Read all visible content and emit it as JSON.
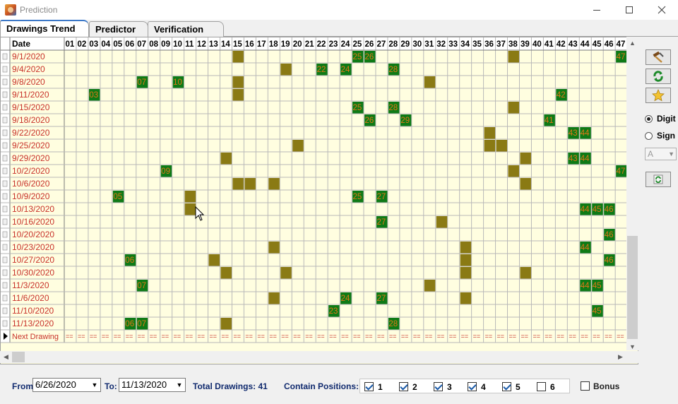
{
  "window": {
    "title": "Prediction"
  },
  "tabs": [
    {
      "label": "Drawings Trend",
      "active": true
    },
    {
      "label": "Predictor",
      "active": false
    },
    {
      "label": "Verification",
      "active": false
    }
  ],
  "grid": {
    "date_header": "Date",
    "columns": [
      "01",
      "02",
      "03",
      "04",
      "05",
      "06",
      "07",
      "08",
      "09",
      "10",
      "11",
      "12",
      "13",
      "14",
      "15",
      "16",
      "17",
      "18",
      "19",
      "20",
      "21",
      "22",
      "23",
      "24",
      "25",
      "26",
      "27",
      "28",
      "29",
      "30",
      "31",
      "32",
      "33",
      "34",
      "35",
      "36",
      "37",
      "38",
      "39",
      "40",
      "41",
      "42",
      "43",
      "44",
      "45",
      "46",
      "47"
    ],
    "rows": [
      {
        "date": "9/1/2020",
        "cells": [
          [
            "15",
            ""
          ],
          [
            "25",
            "25"
          ],
          [
            "26",
            "26"
          ],
          [
            "38",
            ""
          ],
          [
            "47",
            "47"
          ]
        ]
      },
      {
        "date": "9/4/2020",
        "cells": [
          [
            "19",
            ""
          ],
          [
            "22",
            "22"
          ],
          [
            "24",
            "24"
          ],
          [
            "28",
            "28"
          ]
        ]
      },
      {
        "date": "9/8/2020",
        "cells": [
          [
            "07",
            "07"
          ],
          [
            "10",
            "10"
          ],
          [
            "15",
            ""
          ],
          [
            "31",
            ""
          ]
        ]
      },
      {
        "date": "9/11/2020",
        "cells": [
          [
            "03",
            "03"
          ],
          [
            "15",
            ""
          ],
          [
            "42",
            "42"
          ]
        ]
      },
      {
        "date": "9/15/2020",
        "cells": [
          [
            "25",
            "25"
          ],
          [
            "28",
            "28"
          ],
          [
            "38",
            ""
          ]
        ]
      },
      {
        "date": "9/18/2020",
        "cells": [
          [
            "26",
            "26"
          ],
          [
            "29",
            "29"
          ],
          [
            "41",
            "41"
          ]
        ]
      },
      {
        "date": "9/22/2020",
        "cells": [
          [
            "36",
            ""
          ],
          [
            "43",
            "43"
          ],
          [
            "44",
            "44"
          ]
        ]
      },
      {
        "date": "9/25/2020",
        "cells": [
          [
            "20",
            ""
          ],
          [
            "36",
            ""
          ],
          [
            "37",
            ""
          ]
        ]
      },
      {
        "date": "9/29/2020",
        "cells": [
          [
            "14",
            ""
          ],
          [
            "39",
            ""
          ],
          [
            "43",
            "43"
          ],
          [
            "44",
            "44"
          ]
        ]
      },
      {
        "date": "10/2/2020",
        "cells": [
          [
            "09",
            "09"
          ],
          [
            "38",
            ""
          ],
          [
            "47",
            "47"
          ]
        ]
      },
      {
        "date": "10/6/2020",
        "cells": [
          [
            "15",
            ""
          ],
          [
            "16",
            ""
          ],
          [
            "18",
            ""
          ],
          [
            "39",
            ""
          ]
        ]
      },
      {
        "date": "10/9/2020",
        "cells": [
          [
            "05",
            "05"
          ],
          [
            "11",
            ""
          ],
          [
            "25",
            "25"
          ],
          [
            "27",
            "27"
          ]
        ]
      },
      {
        "date": "10/13/2020",
        "cells": [
          [
            "11",
            ""
          ],
          [
            "44",
            "44"
          ],
          [
            "45",
            "45"
          ],
          [
            "46",
            "46"
          ]
        ]
      },
      {
        "date": "10/16/2020",
        "cells": [
          [
            "27",
            "27"
          ],
          [
            "32",
            ""
          ]
        ]
      },
      {
        "date": "10/20/2020",
        "cells": [
          [
            "46",
            "46"
          ]
        ]
      },
      {
        "date": "10/23/2020",
        "cells": [
          [
            "18",
            ""
          ],
          [
            "34",
            ""
          ],
          [
            "44",
            "44"
          ]
        ]
      },
      {
        "date": "10/27/2020",
        "cells": [
          [
            "06",
            "06"
          ],
          [
            "13",
            ""
          ],
          [
            "34",
            ""
          ],
          [
            "46",
            "46"
          ]
        ]
      },
      {
        "date": "10/30/2020",
        "cells": [
          [
            "14",
            ""
          ],
          [
            "19",
            ""
          ],
          [
            "34",
            ""
          ],
          [
            "39",
            ""
          ]
        ]
      },
      {
        "date": "11/3/2020",
        "cells": [
          [
            "07",
            "07"
          ],
          [
            "31",
            ""
          ],
          [
            "44",
            "44"
          ],
          [
            "45",
            "45"
          ]
        ]
      },
      {
        "date": "11/6/2020",
        "cells": [
          [
            "18",
            ""
          ],
          [
            "24",
            "24"
          ],
          [
            "27",
            "27"
          ],
          [
            "34",
            ""
          ]
        ]
      },
      {
        "date": "11/10/2020",
        "cells": [
          [
            "23",
            "23"
          ],
          [
            "45",
            "45"
          ]
        ]
      },
      {
        "date": "11/13/2020",
        "cells": [
          [
            "06",
            "06"
          ],
          [
            "07",
            "07"
          ],
          [
            "14",
            ""
          ],
          [
            "28",
            "28"
          ]
        ]
      }
    ],
    "next_row_label": "Next Drawing",
    "next_row_placeholder": "==",
    "colors": {
      "grid_bg": "#fffee0",
      "header_bg": "#ffffff",
      "gridline": "#b8b8b8",
      "date_text": "#c8322a",
      "hit_green": "#0e7a16",
      "hit_olive": "#8a7a14",
      "hit_text": "#e07818"
    }
  },
  "side_panel": {
    "tool_icons": [
      "hammer-icon",
      "recycle-icon",
      "star-icon",
      "refresh-icon"
    ],
    "radio_digit": "Digit",
    "radio_sign": "Sign",
    "select_value": "A"
  },
  "filters": {
    "from_label": "From:",
    "from_value": "6/26/2020",
    "to_label": "To:",
    "to_value": "11/13/2020",
    "total_label": "Total Drawings: 41",
    "positions_label": "Contain Positions:",
    "positions": [
      {
        "label": "1",
        "checked": true
      },
      {
        "label": "2",
        "checked": true
      },
      {
        "label": "3",
        "checked": true
      },
      {
        "label": "4",
        "checked": true
      },
      {
        "label": "5",
        "checked": true
      },
      {
        "label": "6",
        "checked": false
      }
    ],
    "bonus_label": "Bonus"
  }
}
